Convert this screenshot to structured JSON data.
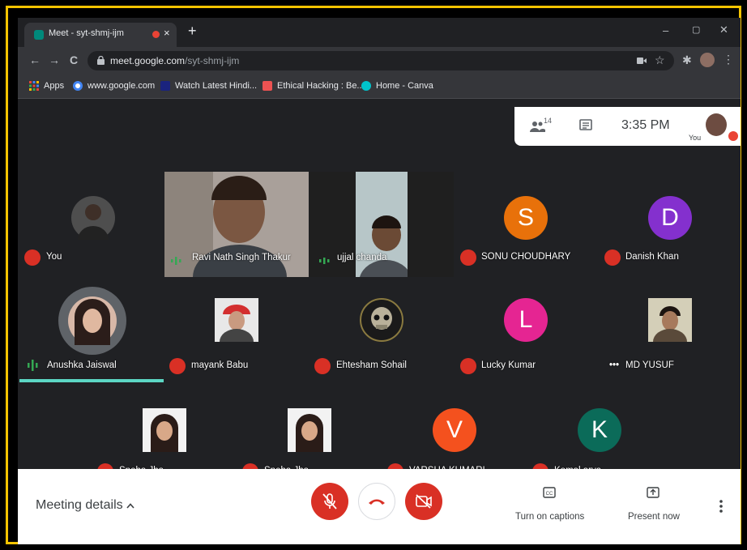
{
  "browser": {
    "tab_title": "Meet - syt-shmj-ijm",
    "tab_close": "×",
    "new_tab": "+",
    "window_controls": {
      "minimize": "–",
      "maximize": "▢",
      "close": "✕"
    },
    "nav": {
      "back": "←",
      "forward": "→",
      "reload": "C"
    },
    "url_host": "meet.google.com",
    "url_path": "/syt-shmj-ijm",
    "star": "☆",
    "extensions": "✱",
    "menu": "⋮"
  },
  "bookmarks": [
    {
      "label": "Apps",
      "icon": "apps-grid-icon"
    },
    {
      "label": "www.google.com",
      "icon": "google-icon"
    },
    {
      "label": "Watch Latest Hindi...",
      "icon": "video-site-icon"
    },
    {
      "label": "Ethical Hacking : Be...",
      "icon": "udemy-icon"
    },
    {
      "label": "Home - Canva",
      "icon": "canva-icon"
    }
  ],
  "meet": {
    "people_count": "14",
    "time": "3:35 PM",
    "you_label": "You",
    "participants": [
      {
        "name": "You",
        "muted": true,
        "avatar": "photo"
      },
      {
        "name": "Ravi Nath Singh Thakur",
        "muted": false,
        "avatar": "video"
      },
      {
        "name": "ujjal chanda",
        "muted": false,
        "avatar": "video"
      },
      {
        "name": "SONU CHOUDHARY",
        "muted": true,
        "avatar": "letter",
        "letter": "S",
        "color": "#e8710a"
      },
      {
        "name": "Danish Khan",
        "muted": true,
        "avatar": "letter",
        "letter": "D",
        "color": "#8430ce"
      },
      {
        "name": "Anushka Jaiswal",
        "muted": false,
        "avatar": "photo"
      },
      {
        "name": "mayank Babu",
        "muted": true,
        "avatar": "photo"
      },
      {
        "name": "Ehtesham Sohail",
        "muted": true,
        "avatar": "photo"
      },
      {
        "name": "Lucky Kumar",
        "muted": true,
        "avatar": "letter",
        "letter": "L",
        "color": "#e52592"
      },
      {
        "name": "MD YUSUF",
        "muted": false,
        "avatar": "photo"
      },
      {
        "name": "Sneha Jha",
        "muted": true,
        "avatar": "photo"
      },
      {
        "name": "Sneha Jha",
        "muted": true,
        "avatar": "photo"
      },
      {
        "name": "VARSHA KUMARI",
        "muted": true,
        "avatar": "letter",
        "letter": "V",
        "color": "#f4511e"
      },
      {
        "name": "Komal arya",
        "muted": true,
        "avatar": "letter",
        "letter": "K",
        "color": "#0b6b59"
      }
    ]
  },
  "controls": {
    "meeting_details": "Meeting details",
    "captions_label": "Turn on captions",
    "present_label": "Present now"
  },
  "colors": {
    "frame_border": "#f5c400",
    "muted_red": "#d93025",
    "speaking_green": "#34a853"
  }
}
